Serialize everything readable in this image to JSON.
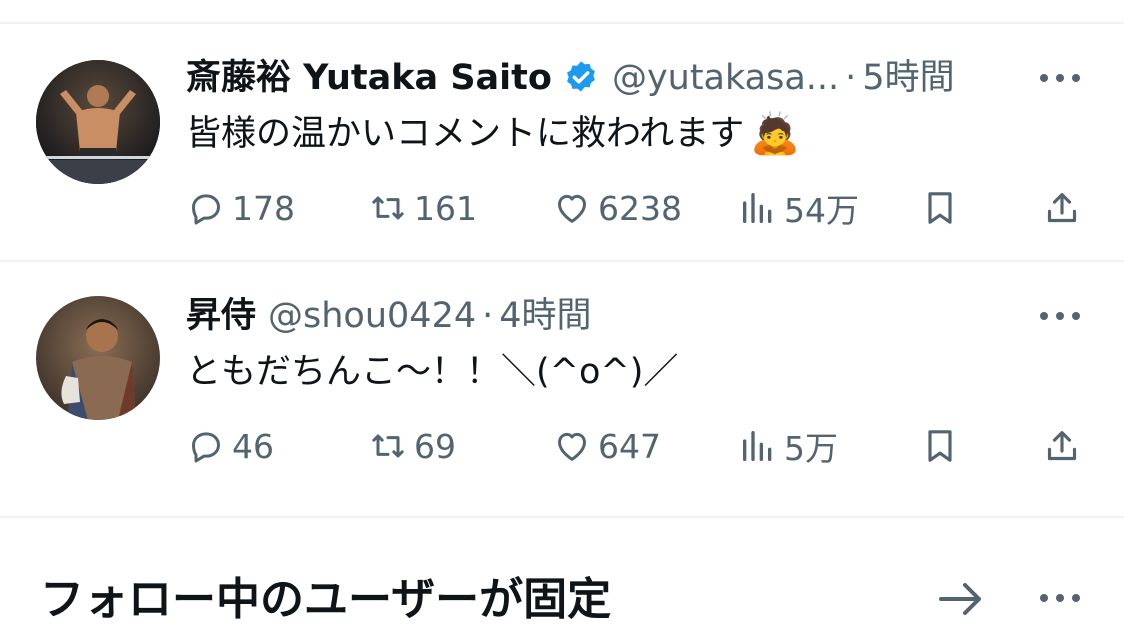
{
  "colors": {
    "verified": "#1d9bf0",
    "muted": "#536471",
    "divider": "#eff3f4"
  },
  "tweets": [
    {
      "display_name": "斎藤裕 Yutaka Saito",
      "verified": true,
      "handle": "@yutakasa...",
      "separator": "·",
      "time": "5時間",
      "text": "皆様の温かいコメントに救われます",
      "emoji": "🙇",
      "replies": "178",
      "retweets": "161",
      "likes": "6238",
      "views": "54万",
      "avatar_icon": "user-avatar-photo-1"
    },
    {
      "display_name": "昇侍",
      "verified": false,
      "handle": "@shou0424",
      "separator": "·",
      "time": "4時間",
      "text": "ともだちんこ～！！＼(^o^)／",
      "emoji": "",
      "replies": "46",
      "retweets": "69",
      "likes": "647",
      "views": "5万",
      "avatar_icon": "user-avatar-photo-2"
    }
  ],
  "section": {
    "title": "フォロー中のユーザーが固定"
  }
}
